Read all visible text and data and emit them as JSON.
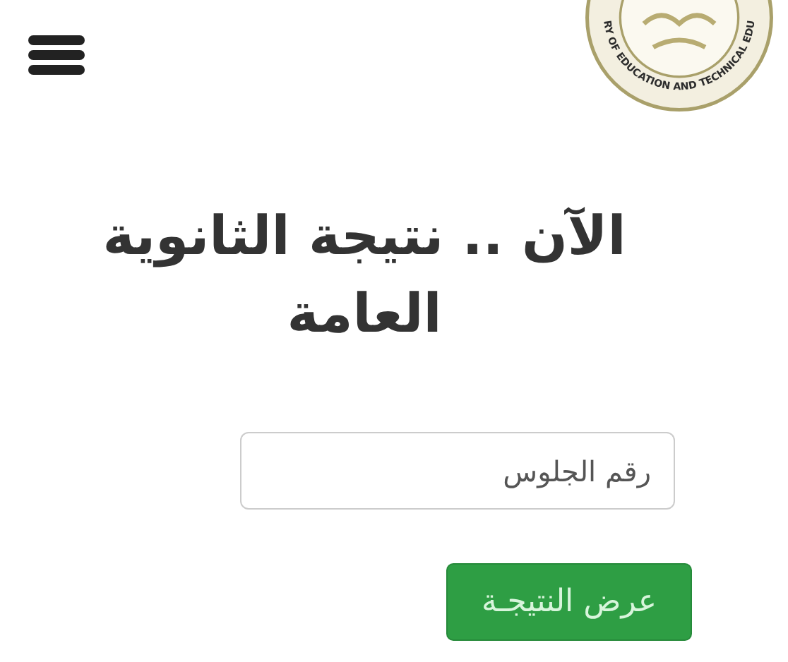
{
  "logo": {
    "ring_text": "RY OF EDUCATION AND TECHNICAL EDU"
  },
  "title": "الآن .. نتيجة الثانوية العامة",
  "seat_number_field": {
    "placeholder": "رقم الجلوس"
  },
  "submit_button": {
    "label": "عرض النتيجـة"
  }
}
